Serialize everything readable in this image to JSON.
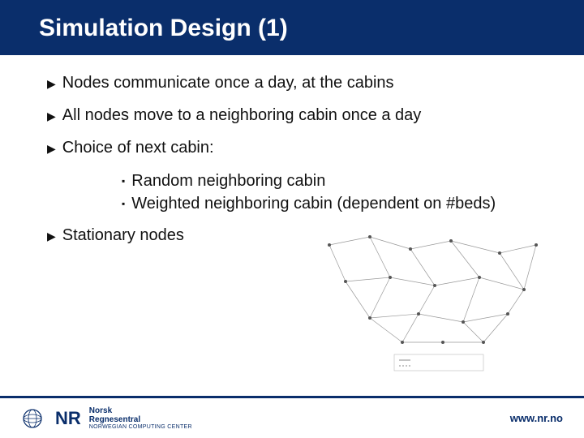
{
  "slide": {
    "title": "Simulation Design (1)"
  },
  "bullets": [
    {
      "text": "Nodes communicate once a day, at the cabins"
    },
    {
      "text": "All nodes move to a neighboring cabin once a day"
    },
    {
      "text": "Choice of next cabin:"
    }
  ],
  "subbullets": [
    {
      "text": "Random neighboring cabin"
    },
    {
      "text": "Weighted neighboring cabin (dependent on #beds)"
    }
  ],
  "bullets_after": [
    {
      "text": "Stationary nodes"
    }
  ],
  "footer": {
    "logo_nr": "NR",
    "logo_line1": "Norsk",
    "logo_line2": "Regnesentral",
    "logo_line3": "NORWEGIAN COMPUTING CENTER",
    "url": "www.nr.no"
  },
  "graph_caption": "",
  "colors": {
    "brand": "#0a2e6b"
  }
}
